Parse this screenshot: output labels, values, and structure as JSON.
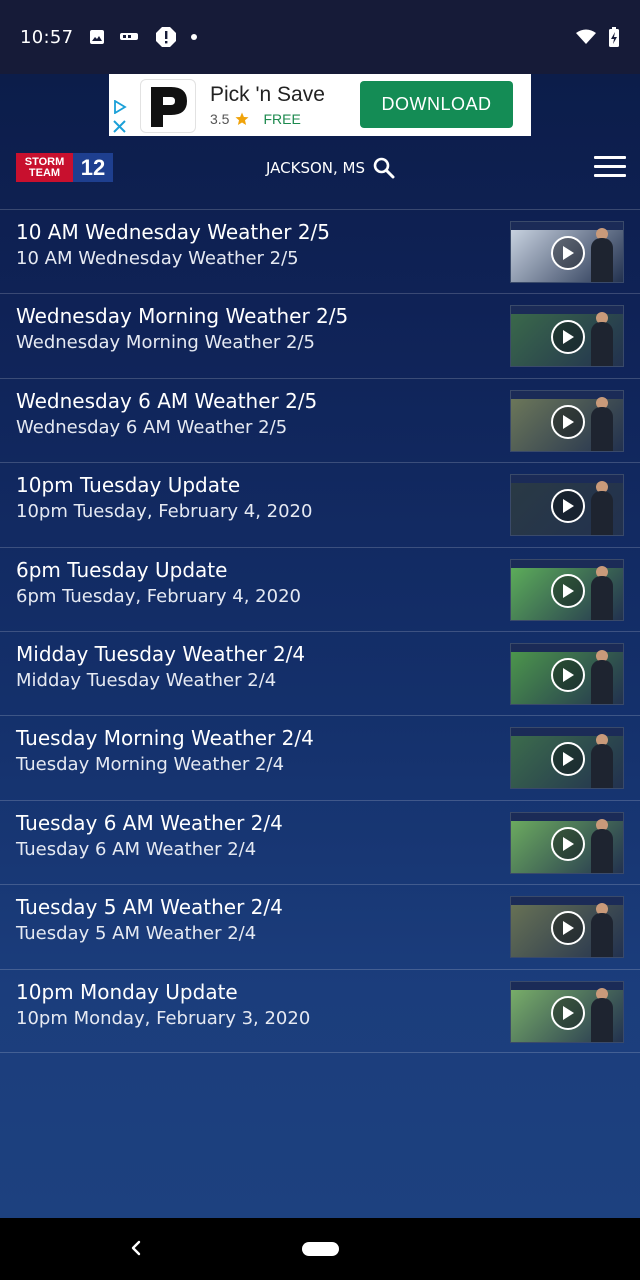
{
  "status_bar": {
    "time": "10:57"
  },
  "ad": {
    "title": "Pick 'n Save",
    "rating": "3.5",
    "price": "FREE",
    "cta": "DOWNLOAD",
    "logo_letter": "P"
  },
  "header": {
    "logo_top": "STORM",
    "logo_bottom": "TEAM",
    "logo_number": "12",
    "location": "JACKSON, MS"
  },
  "videos": [
    {
      "title": "10 AM Wednesday Weather 2/5",
      "subtitle": "10 AM Wednesday Weather 2/5",
      "thumb_color": "#cfd9e6"
    },
    {
      "title": "Wednesday Morning Weather 2/5",
      "subtitle": "Wednesday Morning Weather 2/5",
      "thumb_color": "#3b6b4a"
    },
    {
      "title": "Wednesday 6 AM Weather 2/5",
      "subtitle": "Wednesday 6 AM Weather 2/5",
      "thumb_color": "#6f7a5a"
    },
    {
      "title": "10pm Tuesday Update",
      "subtitle": "10pm Tuesday, February 4, 2020",
      "thumb_color": "#2a3a44"
    },
    {
      "title": "6pm Tuesday Update",
      "subtitle": "6pm Tuesday, February 4, 2020",
      "thumb_color": "#5fb25a"
    },
    {
      "title": "Midday Tuesday Weather 2/4",
      "subtitle": "Midday Tuesday Weather 2/4",
      "thumb_color": "#4e9a4c"
    },
    {
      "title": "Tuesday Morning Weather 2/4",
      "subtitle": "Tuesday Morning Weather 2/4",
      "thumb_color": "#3d6e4c"
    },
    {
      "title": "Tuesday 6 AM Weather 2/4",
      "subtitle": "Tuesday 6 AM Weather 2/4",
      "thumb_color": "#6fb060"
    },
    {
      "title": "Tuesday 5 AM Weather 2/4",
      "subtitle": "Tuesday 5 AM Weather 2/4",
      "thumb_color": "#6a7455"
    },
    {
      "title": "10pm Monday Update",
      "subtitle": "10pm Monday, February 3, 2020",
      "thumb_color": "#7cb36a"
    }
  ],
  "colors": {
    "accent": "#148c55",
    "brand_red": "#c8102e",
    "brand_blue": "#1e3f8f"
  }
}
